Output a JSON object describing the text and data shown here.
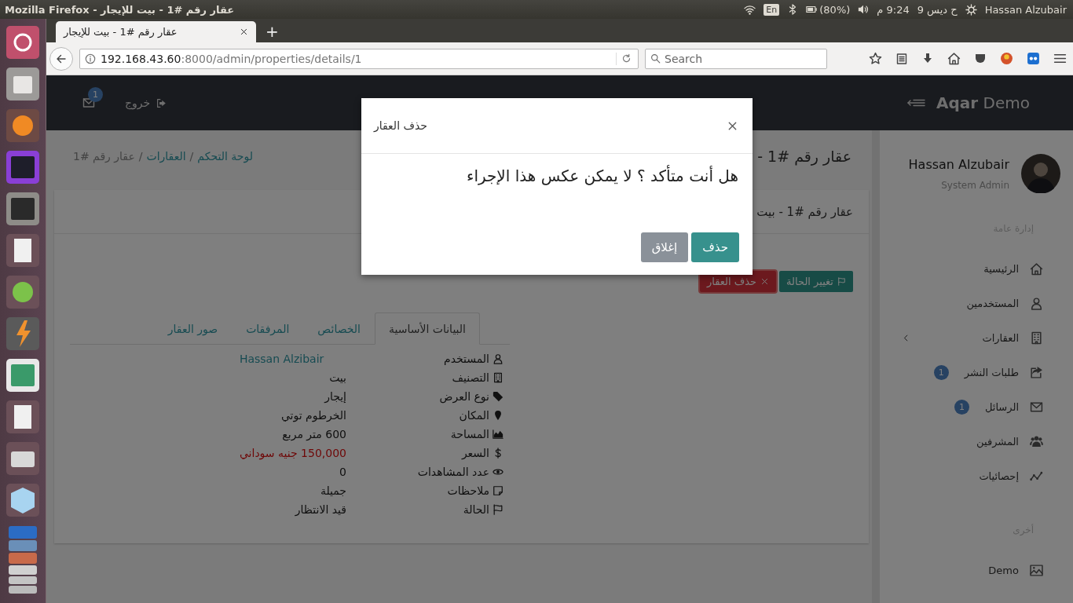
{
  "system_bar": {
    "window_title": "Mozilla Firefox - عقار رقم #1 - بيت للإيجار",
    "keyboard": "En",
    "battery": "(80%)",
    "date": "ح ديس 9",
    "time": "9:24 م",
    "user": "Hassan Alzubair"
  },
  "browser": {
    "tab_title": "عقار رقم #1 - بيت للإيجار",
    "new_tab": "+",
    "url_host": "192.168.43.60",
    "url_path": ":8000/admin/properties/details/1",
    "search": {
      "placeholder": "Search"
    }
  },
  "header": {
    "logo": "**Aqar** Demo",
    "messages_badge": "1",
    "logout": "خروج"
  },
  "page": {
    "title": "عقار رقم #1 -",
    "separator": "/",
    "breadcrumb": [
      {
        "label": "لوحة التحكم",
        "link": true
      },
      {
        "label": "العقارات",
        "link": true
      },
      {
        "label": "عقار رقم #1",
        "link": false
      }
    ]
  },
  "panel": {
    "heading": "عقار رقم #1 - بيت",
    "actions": [
      {
        "label": "تغيير الحالة",
        "kind": "status"
      },
      {
        "label": "حذف العقار",
        "kind": "delete"
      }
    ],
    "tabs": [
      {
        "label": "البيانات الأساسية",
        "selected": true
      },
      {
        "label": "الخصائص",
        "selected": false
      },
      {
        "label": "المرفقات",
        "selected": false
      },
      {
        "label": "صور العقار",
        "selected": false
      }
    ],
    "details": [
      {
        "label": "المستخدم",
        "value": "Hassan Alzibair",
        "kind": "link"
      },
      {
        "label": "التصنيف",
        "value": "بيت",
        "kind": "text"
      },
      {
        "label": "نوع العرض",
        "value": "إيجار",
        "kind": "text"
      },
      {
        "label": "المكان",
        "value": "الخرطوم توتي",
        "kind": "text"
      },
      {
        "label": "المساحة",
        "value": "600 متر مربع",
        "kind": "text"
      },
      {
        "label": "السعر",
        "value": "150,000 جنيه سوداني",
        "kind": "price"
      },
      {
        "label": "عدد المشاهدات",
        "value": "0",
        "kind": "text"
      },
      {
        "label": "ملاحظات",
        "value": "جميلة",
        "kind": "text"
      },
      {
        "label": "الحالة",
        "value": "قيد الانتظار",
        "kind": "text"
      }
    ]
  },
  "sidebar": {
    "name": "Hassan Alzubair",
    "role": "System Admin",
    "sections": [
      {
        "title": "إدارة عامة",
        "items": [
          {
            "label": "الرئيسية",
            "has_submenu": false
          },
          {
            "label": "المستخدمين",
            "has_submenu": false
          },
          {
            "label": "العقارات",
            "has_submenu": true
          },
          {
            "label": "طلبات النشر",
            "badge": "1",
            "has_submenu": false
          },
          {
            "label": "الرسائل",
            "badge": "1",
            "has_submenu": false
          },
          {
            "label": "المشرفين",
            "has_submenu": false
          },
          {
            "label": "إحصائيات",
            "has_submenu": false
          }
        ]
      },
      {
        "title": "أخرى",
        "items": [
          {
            "label": "Demo",
            "has_submenu": false
          }
        ]
      }
    ]
  },
  "modal": {
    "title": "حذف العقار",
    "message": "هل أنت متأكد ؟ لا يمكن عكس هذا الإجراء",
    "buttons": [
      {
        "label": "حذف",
        "kind": "primary"
      },
      {
        "label": "إغلاق",
        "kind": "secondary"
      }
    ]
  }
}
